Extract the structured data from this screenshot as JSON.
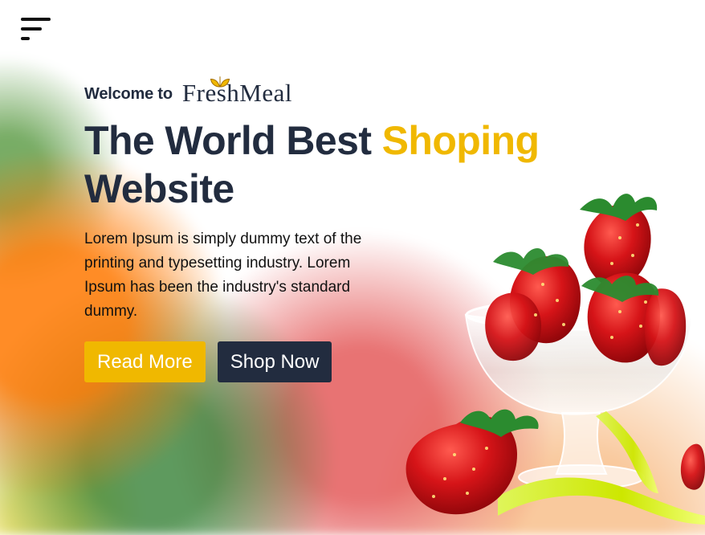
{
  "welcome": {
    "prefix": "Welcome to",
    "brand": "FreshMeal"
  },
  "hero": {
    "title_part1": "The World Best ",
    "title_accent": "Shoping",
    "title_part2": "Website",
    "description": "Lorem Ipsum is simply dummy text of the printing and typesetting industry. Lorem Ipsum has been the industry's standard dummy."
  },
  "buttons": {
    "read_more": "Read More",
    "shop_now": "Shop Now"
  },
  "colors": {
    "accent": "#f0b800",
    "dark": "#222c3f",
    "white": "#ffffff"
  },
  "icons": {
    "menu": "menu-icon",
    "logo_leaf": "leaf-icon"
  }
}
